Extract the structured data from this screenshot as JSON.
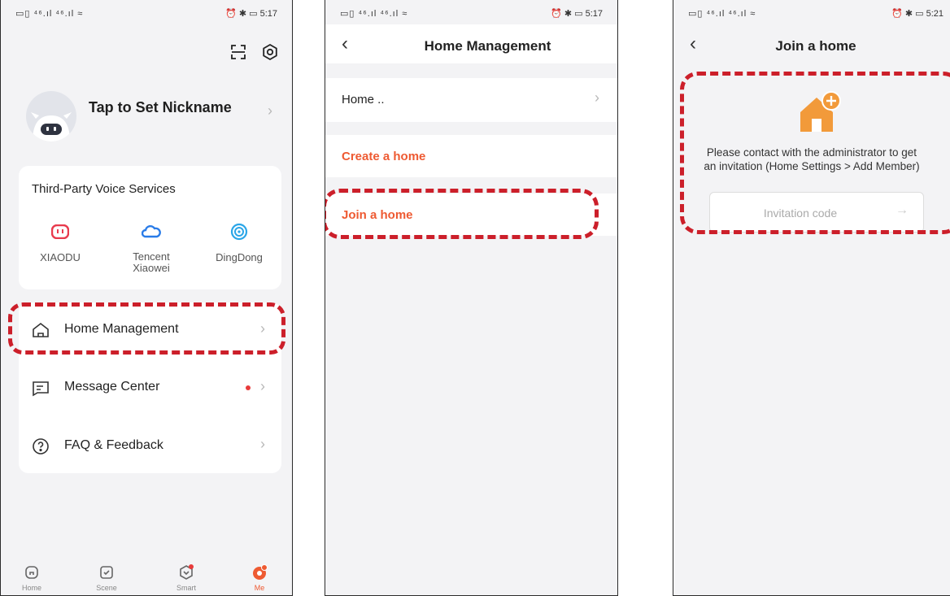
{
  "status": {
    "left": "▭▯ ⁴⁶.ıl ⁴⁶.ıl ≈",
    "p1_right": "⏰ ✱ ▭ 5:17",
    "p2_right": "⏰ ✱ ▭ 5:17",
    "p3_right": "⏰ ✱ ▭ 5:21"
  },
  "me": {
    "nickname_label": "Tap to Set Nickname",
    "voice_title": "Third-Party Voice Services",
    "voice_services": [
      "XIAODU",
      "Tencent Xiaowei",
      "DingDong"
    ],
    "menu": [
      "Home Management",
      "Message Center",
      "FAQ & Feedback"
    ],
    "tabs": [
      "Home",
      "Scene",
      "Smart",
      "Me"
    ]
  },
  "home_mgmt": {
    "title": "Home Management",
    "home_item": "Home ..",
    "create": "Create a home",
    "join": "Join a home"
  },
  "join": {
    "title": "Join a home",
    "message_line1": "Please contact with the administrator to get",
    "message_line2": "an invitation (Home Settings > Add Member)",
    "invitation_placeholder": "Invitation code"
  },
  "colors": {
    "accent": "#ee5a32",
    "highlight": "#cc1f2a"
  },
  "icons": {
    "scan": "scan-icon",
    "settings": "settings-icon",
    "home": "home-icon",
    "message": "message-icon",
    "faq": "question-icon",
    "back": "back-icon"
  }
}
